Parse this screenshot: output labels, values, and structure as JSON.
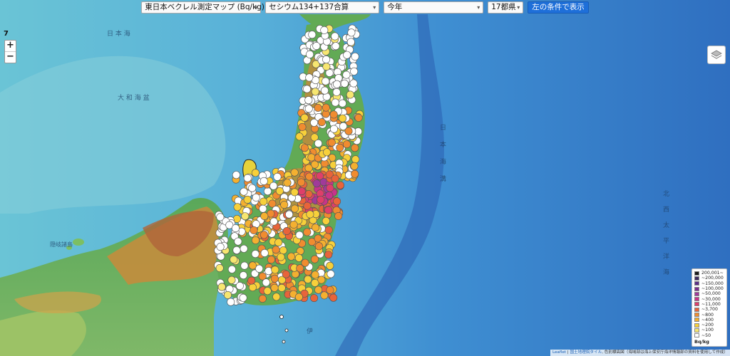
{
  "controls": {
    "map_select": "東日本ベクレル測定マップ (Bq/kg)",
    "isotope_select": "セシウム134+137合算",
    "period_select": "今年",
    "region_select": "17都県",
    "show_button": "左の条件で表示"
  },
  "zoom": {
    "level": "7",
    "in": "+",
    "out": "−"
  },
  "legend": {
    "unit": "Bq/kg",
    "items": [
      {
        "label": "200,001~",
        "color": "#1a1a1a"
      },
      {
        "label": "~200,000",
        "color": "#3d2a5c"
      },
      {
        "label": "~150,000",
        "color": "#5a2f86"
      },
      {
        "label": "~100,000",
        "color": "#7a2e8e"
      },
      {
        "label": "~50,000",
        "color": "#a03a9a"
      },
      {
        "label": "~30,000",
        "color": "#c8338a"
      },
      {
        "label": "~11,000",
        "color": "#df3f6a"
      },
      {
        "label": "~3,700",
        "color": "#e8643a"
      },
      {
        "label": "~800",
        "color": "#f08c30"
      },
      {
        "label": "~400",
        "color": "#f4b030"
      },
      {
        "label": "~200",
        "color": "#f7d03a"
      },
      {
        "label": "~100",
        "color": "#f7e670"
      },
      {
        "label": "~50",
        "color": "#ffffff"
      }
    ]
  },
  "attribution": {
    "leaflet": "Leaflet",
    "sep": " | ",
    "gsi": "国土地理院タイル",
    "rest": ", 色別標高図（海域部は海上保安庁海洋情報部の資料を使用して作成）"
  },
  "map_labels": {
    "sea_japan": "日 本 海",
    "yamato": "大 和 海 盆",
    "pacific": [
      "北",
      "西",
      "太",
      "平",
      "洋",
      "海"
    ],
    "trench": [
      "日",
      "本",
      "海",
      "溝"
    ],
    "oki": "隠岐諸島",
    "izu": "伊"
  },
  "icons": {
    "layers": "layers-icon",
    "caret": "chevron-down-icon"
  }
}
